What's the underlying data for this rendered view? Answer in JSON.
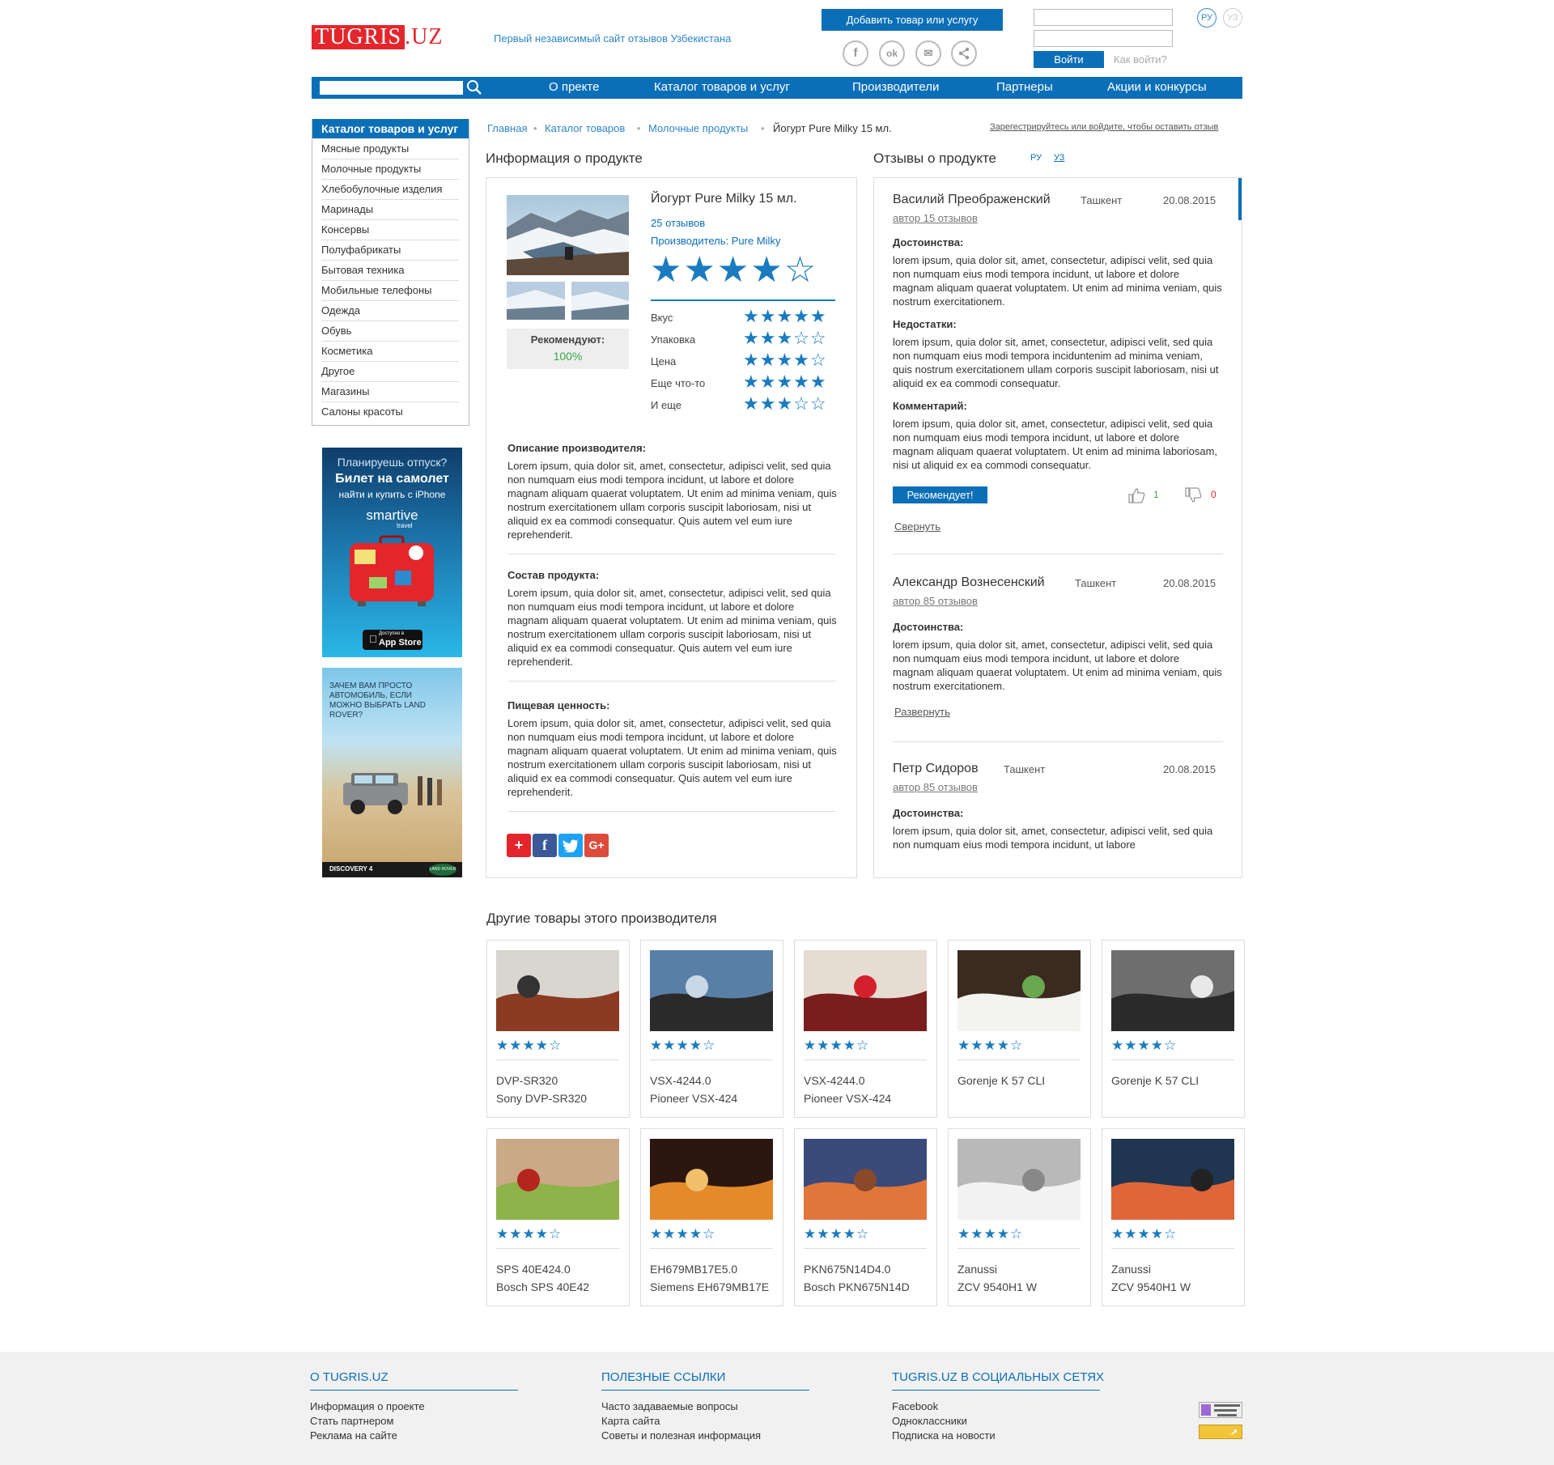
{
  "header": {
    "logo_part1": "TUGRIS",
    "logo_part2": ".UZ",
    "tagline": "Первый независимый сайт отзывов Узбекистана",
    "add_button": "Добавить товар или услугу",
    "social": [
      {
        "icon": "facebook-icon",
        "glyph": "f"
      },
      {
        "icon": "odnoklassniki-icon",
        "glyph": "ok"
      },
      {
        "icon": "mail-icon",
        "glyph": "✉"
      },
      {
        "icon": "share-icon",
        "glyph": "⋖"
      }
    ],
    "login_button": "Войти",
    "how_login": "Как войти?",
    "lang_ru": "РУ",
    "lang_uz": "УЗ"
  },
  "nav": {
    "items": [
      "О пректе",
      "Каталог товаров и услуг",
      "Производители",
      "Партнеры",
      "Акции и конкурсы"
    ]
  },
  "sidebar": {
    "title": "Каталог товаров и услуг",
    "items": [
      "Мясные продукты",
      "Молочные продукты",
      "Хлебобулочные изделия",
      "Маринады",
      "Консервы",
      "Полуфабрикаты",
      "Бытовая техника",
      "Мобильные телефоны",
      "Одежда",
      "Обувь",
      "Косметика",
      "Другое",
      "Магазины",
      "Салоны красоты"
    ]
  },
  "ads": {
    "ad1_line1": "Планируешь отпуск?",
    "ad1_line2": "Билет на самолет",
    "ad1_line3": "найти и купить с iPhone",
    "ad1_brand": "smartive",
    "ad1_brand_sub": "travel",
    "ad1_store_small": "Доступно в",
    "ad1_store": "App Store",
    "ad2_text": "ЗАЧЕМ ВАМ ПРОСТО АВТОМОБИЛЬ, ЕСЛИ МОЖНО ВЫБРАТЬ LAND ROVER?",
    "ad2_model": "DISCOVERY 4",
    "ad2_badge": "LAND ROVER"
  },
  "breadcrumb": {
    "items": [
      "Главная",
      "Каталог товаров",
      "Молочные продукты"
    ],
    "current": "Йогурт Pure Milky 15 мл.",
    "register_link": "Зарегестрируйтесь или войдите, чтобы оставить отзыв"
  },
  "product": {
    "section_title": "Информация о продукте",
    "name": "Йогурт Pure Milky 15 мл.",
    "reviews_count": "25 отзывов",
    "manufacturer": "Производитель: Pure Milky",
    "rating": 4,
    "recommend_label": "Рекомендуют:",
    "recommend_value": "100%",
    "criteria": [
      {
        "label": "Вкус",
        "rating": 5
      },
      {
        "label": "Упаковка",
        "rating": 3
      },
      {
        "label": "Цена",
        "rating": 4
      },
      {
        "label": "Еще что-то",
        "rating": 5
      },
      {
        "label": "И еще",
        "rating": 3
      }
    ],
    "sections": [
      {
        "title": "Описание производителя:",
        "text": "Lorem ipsum, quia dolor sit, amet, consectetur, adipisci velit, sed quia non numquam eius modi tempora incidunt, ut labore et dolore magnam aliquam quaerat voluptatem. Ut enim ad minima veniam, quis nostrum exercitationem ullam corporis suscipit laboriosam, nisi ut aliquid ex ea commodi consequatur. Quis autem vel eum iure reprehenderit."
      },
      {
        "title": "Состав продукта:",
        "text": "Lorem ipsum, quia dolor sit, amet, consectetur, adipisci velit, sed quia non numquam eius modi tempora incidunt, ut labore et dolore magnam aliquam quaerat voluptatem. Ut enim ad minima veniam, quis nostrum exercitationem ullam corporis suscipit laboriosam, nisi ut aliquid ex ea commodi consequatur. Quis autem vel eum iure reprehenderit."
      },
      {
        "title": "Пищевая ценность:",
        "text": "Lorem ipsum, quia dolor sit, amet, consectetur, adipisci velit, sed quia non numquam eius modi tempora incidunt, ut labore et dolore magnam aliquam quaerat voluptatem. Ut enim ad minima veniam, quis nostrum exercitationem ullam corporis suscipit laboriosam, nisi ut aliquid ex ea commodi consequatur. Quis autem vel eum iure reprehenderit."
      }
    ]
  },
  "reviews": {
    "section_title": "Отзывы о продукте",
    "lang_ru": "РУ",
    "lang_uz": "УЗ",
    "items": [
      {
        "name": "Василий Преображенский",
        "city": "Ташкент",
        "date": "20.08.2015",
        "author": "автор 15 отзывов",
        "pros_title": "Достоинства:",
        "pros": "lorem ipsum, quia dolor sit, amet, consectetur, adipisci velit, sed quia non numquam eius modi tempora incidunt, ut labore et dolore magnam aliquam quaerat voluptatem. Ut enim ad minima veniam, quis nostrum exercitationem.",
        "cons_title": "Недостатки:",
        "cons": "lorem ipsum, quia dolor sit, amet, consectetur, adipisci velit, sed quia non numquam eius modi tempora inciduntenim ad minima veniam, quis nostrum exercitationem ullam corporis suscipit laboriosam, nisi ut aliquid ex ea commodi consequatur.",
        "comment_title": "Комментарий:",
        "comment": "lorem ipsum, quia dolor sit, amet, consectetur, adipisci velit, sed quia non numquam eius modi tempora incidunt, ut labore et dolore magnam aliquam quaerat voluptatem. Ut enim ad minima laboriosam, nisi ut aliquid ex ea commodi consequatur.",
        "recommend": "Рекомендует!",
        "likes": "1",
        "dislikes": "0",
        "toggle": "Свернуть"
      },
      {
        "name": "Александр Вознесенский",
        "city": "Ташкент",
        "date": "20.08.2015",
        "author": "автор 85 отзывов",
        "pros_title": "Достоинства:",
        "pros": "lorem ipsum, quia dolor sit, amet, consectetur, adipisci velit, sed quia non numquam eius modi tempora incidunt, ut labore et dolore magnam aliquam quaerat voluptatem. Ut enim ad minima veniam, quis nostrum exercitationem.",
        "toggle": "Развернуть"
      },
      {
        "name": "Петр Сидоров",
        "city": "Ташкент",
        "date": "20.08.2015",
        "author": "автор 85 отзывов",
        "pros_title": "Достоинства:",
        "pros": "lorem ipsum, quia dolor sit, amet, consectetur, adipisci velit, sed quia non numquam eius modi tempora incidunt, ut labore"
      }
    ]
  },
  "other": {
    "title": "Другие товары этого производителя",
    "cards": [
      {
        "line1": "DVP-SR320",
        "line2": "Sony DVP-SR320",
        "rating": 4
      },
      {
        "line1": "VSX-4244.0",
        "line2": "Pioneer VSX-424",
        "rating": 4
      },
      {
        "line1": "VSX-4244.0",
        "line2": "Pioneer VSX-424",
        "rating": 4
      },
      {
        "line1": "Gorenje K 57 CLI",
        "line2": "",
        "rating": 4
      },
      {
        "line1": "Gorenje K 57 CLI",
        "line2": "",
        "rating": 4
      },
      {
        "line1": "SPS 40E424.0",
        "line2": "Bosch SPS 40E42",
        "rating": 4
      },
      {
        "line1": "EH679MB17E5.0",
        "line2": "Siemens EH679MB17E",
        "rating": 4
      },
      {
        "line1": "PKN675N14D4.0",
        "line2": "Bosch PKN675N14D",
        "rating": 4
      },
      {
        "line1": "Zanussi",
        "line2": "ZCV 9540H1 W",
        "rating": 4
      },
      {
        "line1": "Zanussi",
        "line2": "ZCV 9540H1 W",
        "rating": 4
      }
    ]
  },
  "footer": {
    "cols": [
      {
        "title": "О TUGRIS.UZ",
        "links": [
          "Информация о проекте",
          "Стать партнером",
          "Реклама на сайте"
        ]
      },
      {
        "title": "ПОЛЕЗНЫЕ ССЫЛКИ",
        "links": [
          "Часто задаваемые вопросы",
          "Карта сайта",
          "Советы и полезная информация"
        ]
      },
      {
        "title": "TUGRIS.UZ В СОЦИАЛЬНЫХ СЕТЯХ",
        "links": [
          "Facebook",
          "Одноклассники",
          "Подписка на новости"
        ]
      }
    ]
  },
  "colors": {
    "accent": "#0b6fb8",
    "logo_red": "#e3262b",
    "green": "#3aa64c",
    "red": "#e3262b"
  }
}
